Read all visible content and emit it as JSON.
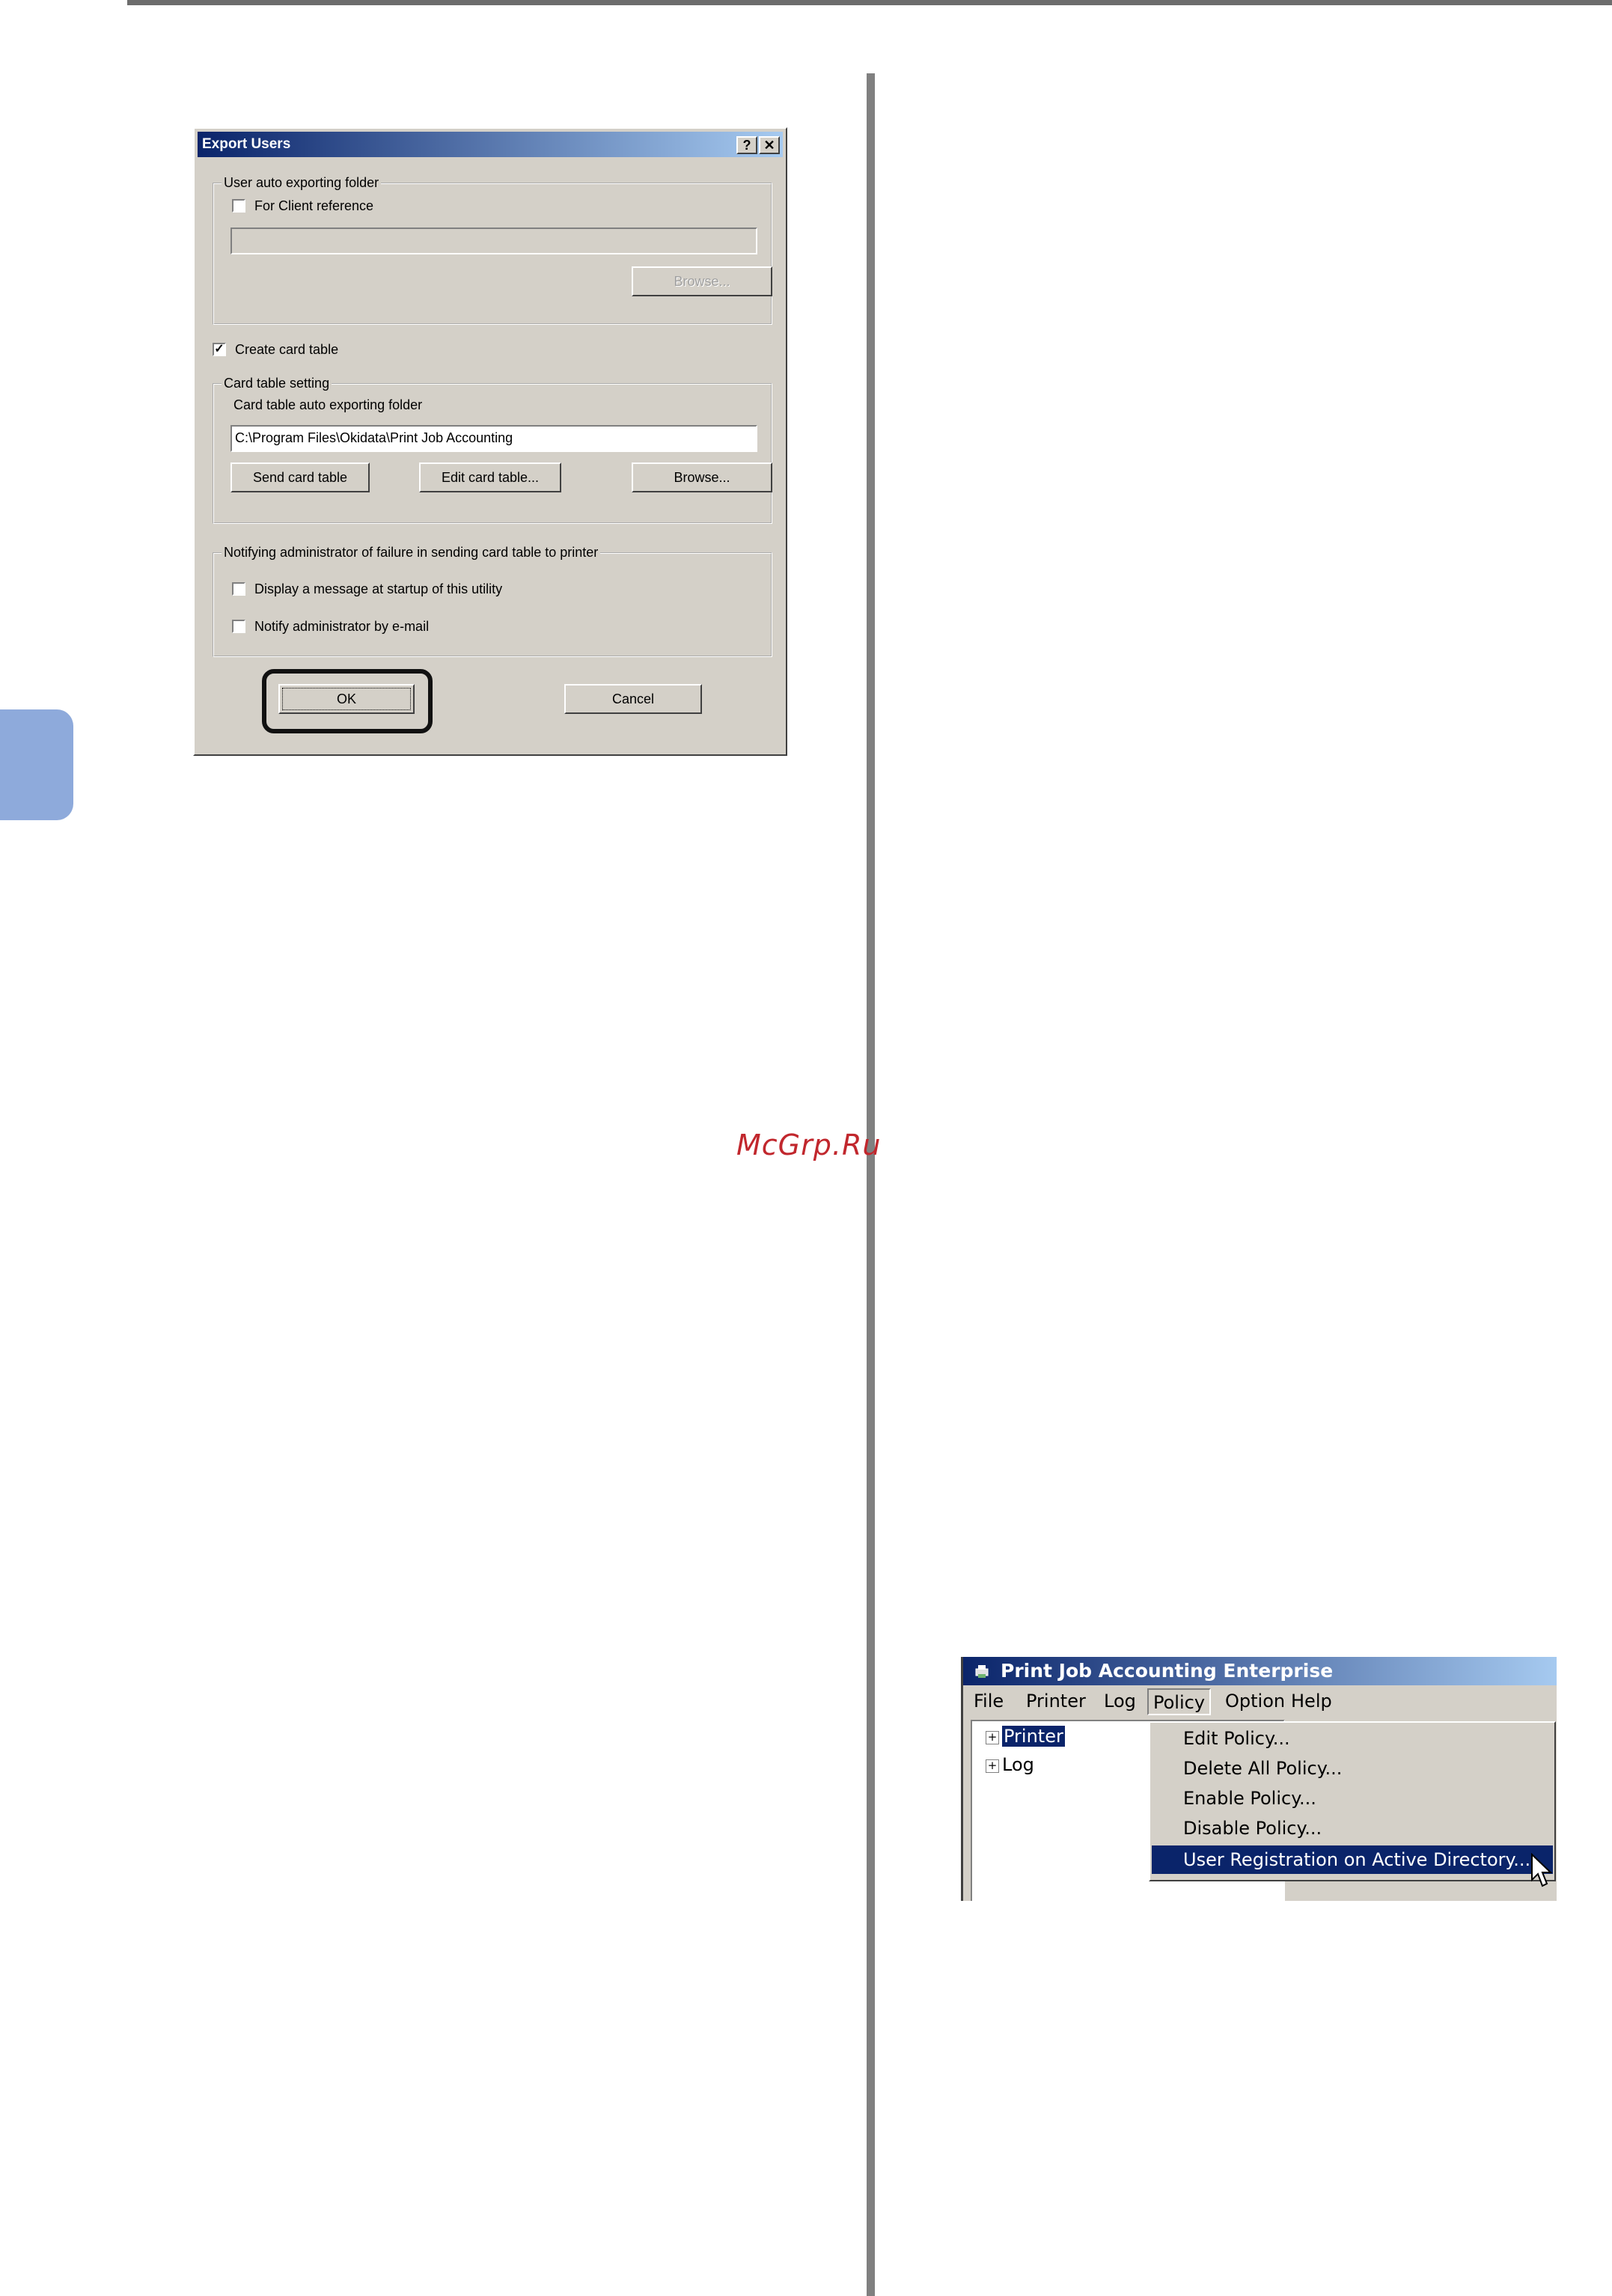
{
  "watermark": "McGrp.Ru",
  "export_dialog": {
    "title": "Export Users",
    "help_button": "?",
    "close_button": "✕",
    "auto_folder_group": {
      "legend": "User auto exporting folder",
      "client_reference_label": "For Client reference",
      "client_reference_checked": false,
      "path_value": "",
      "browse_label": "Browse..."
    },
    "create_card_table_label": "Create card table",
    "create_card_table_checked": true,
    "card_table_group": {
      "legend": "Card table setting",
      "folder_label": "Card table auto exporting folder",
      "path_value": "C:\\Program Files\\Okidata\\Print Job Accounting",
      "send_label": "Send card table",
      "edit_label": "Edit card table...",
      "browse_label": "Browse..."
    },
    "notify_group": {
      "legend": "Notifying administrator of failure in sending card table to printer",
      "display_message_label": "Display a message at startup of this utility",
      "notify_email_label": "Notify administrator by e-mail"
    },
    "ok_label": "OK",
    "cancel_label": "Cancel"
  },
  "pja_window": {
    "title": "Print Job Accounting Enterprise",
    "menu": [
      "File",
      "Printer",
      "Log",
      "Policy",
      "Option",
      "Help"
    ],
    "tree": [
      {
        "label": "Printer",
        "expander": "+"
      },
      {
        "label": "Log",
        "expander": "+"
      }
    ],
    "policy_menu": [
      "Edit Policy...",
      "Delete All Policy...",
      "Enable Policy...",
      "Disable Policy...",
      "User Registration on Active Directory..."
    ],
    "highlighted_item": "User Registration on Active Directory..."
  },
  "colors": {
    "title_bar_start": "#0a246a",
    "title_bar_end": "#a6caf0",
    "dialog_face": "#d4d0c8",
    "side_tab": "#8eaadb",
    "watermark": "#c1272d"
  }
}
